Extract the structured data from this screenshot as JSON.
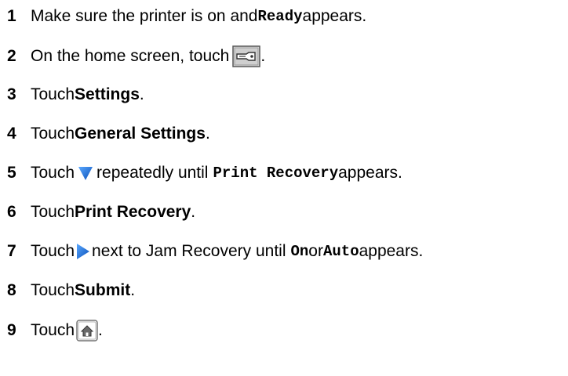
{
  "steps": [
    {
      "number": "1",
      "parts": [
        "Make sure the printer is on and ",
        "Ready",
        " appears."
      ]
    },
    {
      "number": "2",
      "parts": [
        "On the home screen, touch ",
        "."
      ],
      "icon": "menu-key-icon"
    },
    {
      "number": "3",
      "parts": [
        "Touch ",
        "Settings",
        "."
      ]
    },
    {
      "number": "4",
      "parts": [
        "Touch ",
        "General Settings",
        "."
      ]
    },
    {
      "number": "5",
      "parts": [
        "Touch ",
        " repeatedly until ",
        "Print Recovery",
        " appears."
      ],
      "icon": "down-arrow-icon"
    },
    {
      "number": "6",
      "parts": [
        "Touch ",
        "Print Recovery",
        "."
      ]
    },
    {
      "number": "7",
      "parts": [
        "Touch ",
        " next to Jam Recovery until ",
        "On",
        " or ",
        "Auto",
        " appears."
      ],
      "icon": "right-arrow-icon"
    },
    {
      "number": "8",
      "parts": [
        "Touch ",
        "Submit",
        "."
      ]
    },
    {
      "number": "9",
      "parts": [
        "Touch ",
        "."
      ],
      "icon": "home-icon"
    }
  ],
  "colors": {
    "arrow_blue": "#1a6fd9",
    "icon_gray": "#8a8a8a"
  }
}
